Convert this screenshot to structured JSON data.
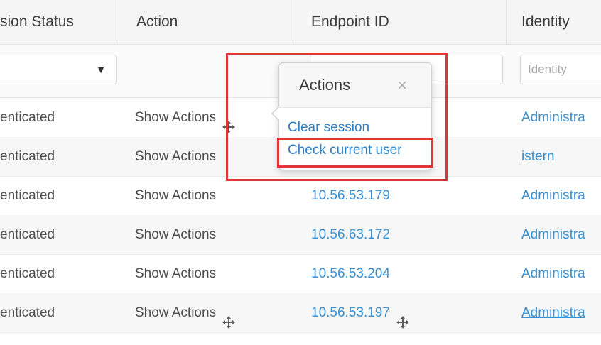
{
  "columns": {
    "session_status": "sion Status",
    "action": "Action",
    "endpoint_id": "Endpoint ID",
    "identity": "Identity"
  },
  "filters": {
    "status_value": "",
    "endpoint_value": "",
    "identity_placeholder": "Identity"
  },
  "popover": {
    "title": "Actions",
    "close": "×",
    "items": [
      "Clear session",
      "Check current user"
    ]
  },
  "rows": [
    {
      "status": "enticated",
      "action": "Show Actions",
      "endpoint": "",
      "identity": "Administra",
      "action_icon": true,
      "endpoint_icon": false
    },
    {
      "status": "enticated",
      "action": "Show Actions",
      "endpoint": "",
      "identity": "istern",
      "action_icon": false,
      "endpoint_icon": false
    },
    {
      "status": "enticated",
      "action": "Show Actions",
      "endpoint": "10.56.53.179",
      "identity": "Administra",
      "action_icon": false,
      "endpoint_icon": false
    },
    {
      "status": "enticated",
      "action": "Show Actions",
      "endpoint": "10.56.63.172",
      "identity": "Administra",
      "action_icon": false,
      "endpoint_icon": false
    },
    {
      "status": "enticated",
      "action": "Show Actions",
      "endpoint": "10.56.53.204",
      "identity": "Administra",
      "action_icon": false,
      "endpoint_icon": false
    },
    {
      "status": "enticated",
      "action": "Show Actions",
      "endpoint": "10.56.53.197",
      "identity": "Administra",
      "action_icon": true,
      "endpoint_icon": true
    }
  ],
  "icons": {
    "move": "move-arrows-icon",
    "caret": "caret-down-icon",
    "close": "close-icon"
  },
  "colors": {
    "link": "#3a8fd1",
    "highlight": "#e23636",
    "header_bg": "#f5f5f5"
  }
}
